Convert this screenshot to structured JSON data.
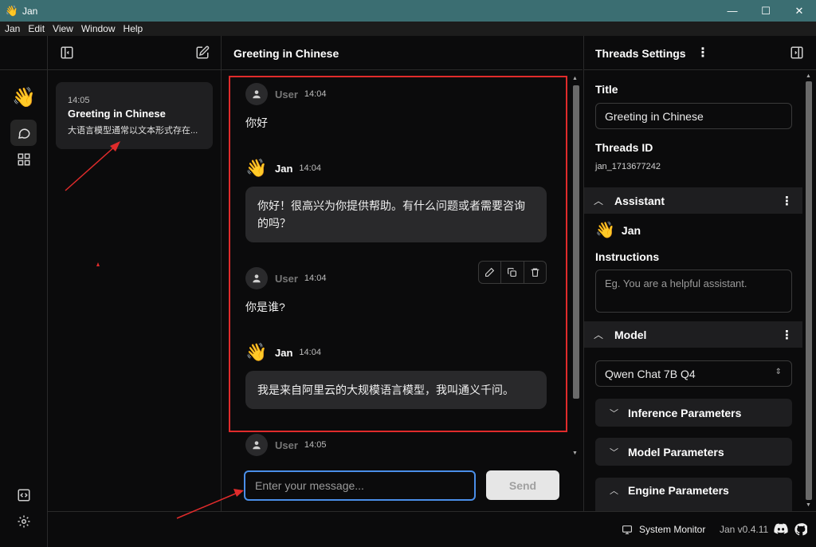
{
  "window": {
    "title": "Jan",
    "app_icon": "👋",
    "controls": {
      "minimize": "—",
      "maximize": "☐",
      "close": "✕"
    }
  },
  "menu": [
    "Jan",
    "Edit",
    "View",
    "Window",
    "Help"
  ],
  "rail": {
    "logo": "👋",
    "icons": [
      "chat-icon",
      "grid-icon",
      "code-icon",
      "settings-icon"
    ]
  },
  "thread_list": {
    "items": [
      {
        "time": "14:05",
        "title": "Greeting in Chinese",
        "snippet": "大语言模型通常以文本形式存在..."
      }
    ]
  },
  "chat": {
    "title": "Greeting in Chinese",
    "messages": [
      {
        "sender": "User",
        "time": "14:04",
        "text": "你好"
      },
      {
        "sender": "Jan",
        "time": "14:04",
        "text": "你好！很高兴为你提供帮助。有什么问题或者需要咨询的吗？"
      },
      {
        "sender": "User",
        "time": "14:04",
        "text": "你是谁?"
      },
      {
        "sender": "Jan",
        "time": "14:04",
        "text": "我是来自阿里云的大规模语言模型，我叫通义千问。"
      },
      {
        "sender": "User",
        "time": "14:05",
        "text": ""
      }
    ],
    "input_placeholder": "Enter your message...",
    "send_label": "Send"
  },
  "settings": {
    "header": "Threads Settings",
    "title_label": "Title",
    "title_value": "Greeting in Chinese",
    "threads_id_label": "Threads ID",
    "threads_id_value": "jan_1713677242",
    "assistant_section": "Assistant",
    "assistant_name": "Jan",
    "assistant_icon": "👋",
    "instructions_label": "Instructions",
    "instructions_placeholder": "Eg. You are a helpful assistant.",
    "model_section": "Model",
    "model_value": "Qwen Chat 7B Q4",
    "subsections": [
      "Inference Parameters",
      "Model Parameters",
      "Engine Parameters"
    ]
  },
  "footer": {
    "system_monitor": "System Monitor",
    "version": "Jan v0.4.11"
  },
  "colors": {
    "highlight": "#e02b2b",
    "accent_input": "#4a8ee8",
    "titlebar": "#3b6e72"
  }
}
